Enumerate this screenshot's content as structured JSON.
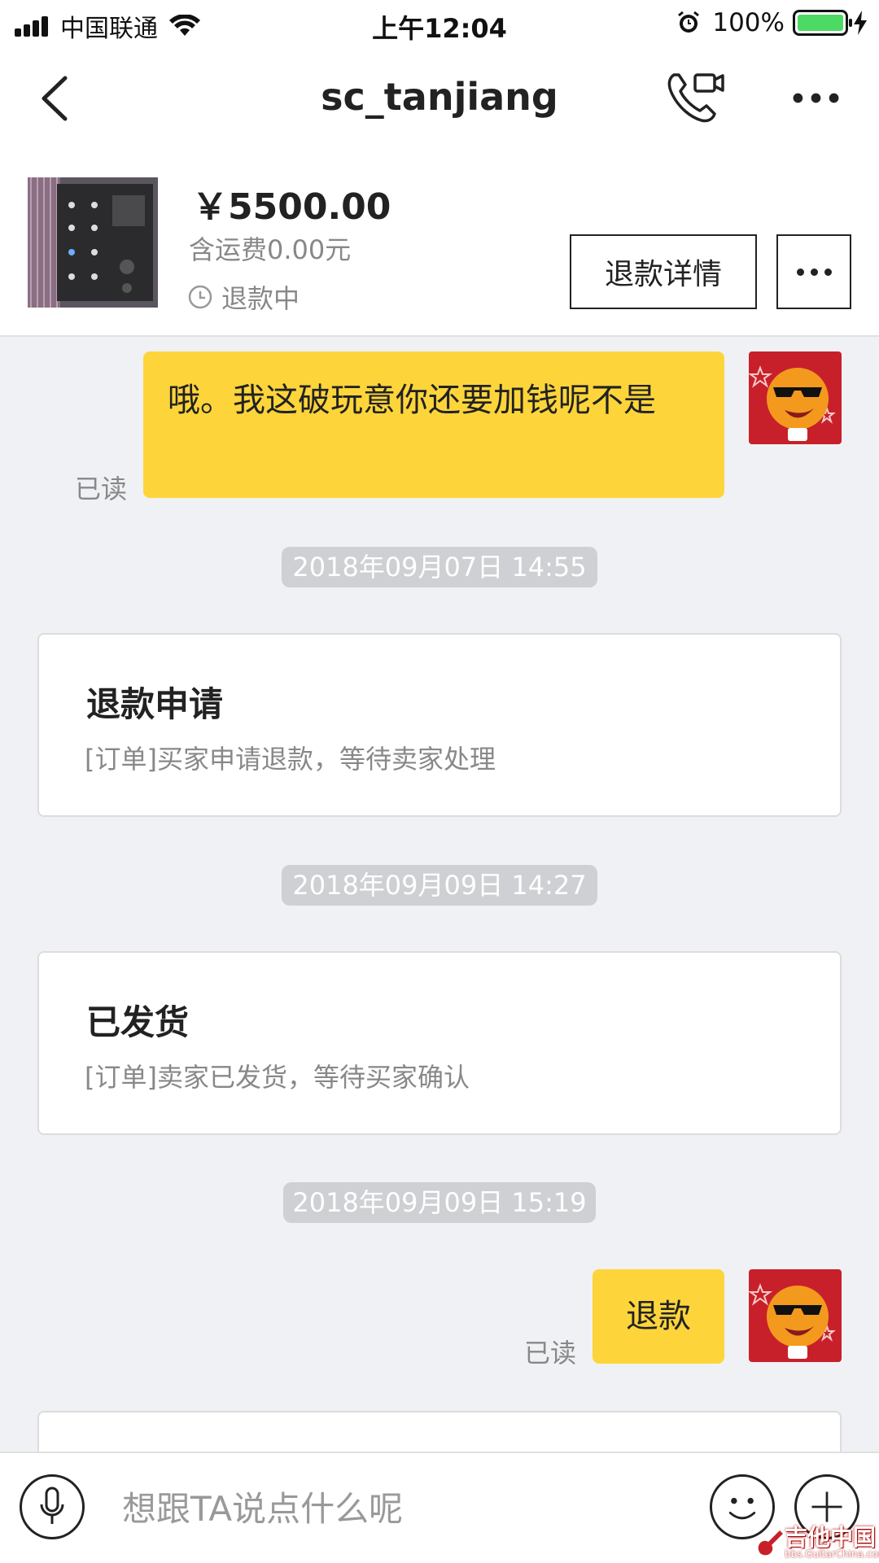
{
  "status_bar": {
    "carrier": "中国联通",
    "time": "上午12:04",
    "battery_percent": "100%",
    "battery_level": 1.0,
    "icons": [
      "signal-icon",
      "wifi-icon",
      "alarm-icon",
      "battery-icon",
      "charging-icon"
    ]
  },
  "nav": {
    "title": "sc_tanjiang",
    "icons": [
      "back-icon",
      "phone-video-icon",
      "more-icon"
    ]
  },
  "order": {
    "price": "￥5500.00",
    "shipping": "含运费0.00元",
    "status": "退款中",
    "refund_detail_label": "退款详情"
  },
  "messages": {
    "msg1_text": "哦。我这破玩意你还要加钱呢不是",
    "msg1_read": "已读",
    "ts1": "2018年09月07日 14:55",
    "card1_title": "退款申请",
    "card1_sub": "[订单]买家申请退款，等待卖家处理",
    "ts2": "2018年09月09日 14:27",
    "card2_title": "已发货",
    "card2_sub": "[订单]卖家已发货，等待买家确认",
    "ts3": "2018年09月09日 15:19",
    "msg2_text": "退款",
    "msg2_read": "已读"
  },
  "input": {
    "placeholder": "想跟TA说点什么呢",
    "icons": [
      "microphone-icon",
      "emoji-icon",
      "plus-icon"
    ]
  },
  "watermark": {
    "main": "吉他中国",
    "sub": "bbs.GuitarChina.com"
  },
  "colors": {
    "bubble": "#fdd53b",
    "background": "#f0f1f4",
    "timestamp_bg": "#cfd0d3",
    "battery": "#4cd964"
  }
}
